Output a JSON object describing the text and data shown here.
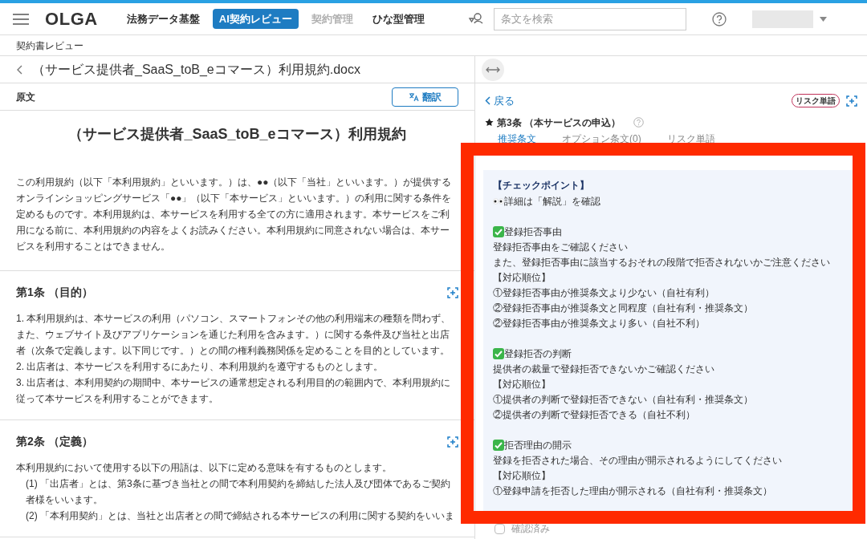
{
  "header": {
    "logo": "OLGA",
    "nav": [
      {
        "label": "法務データ基盤",
        "selected": false,
        "disabled": false
      },
      {
        "label": "AI契約レビュー",
        "selected": true,
        "disabled": false
      },
      {
        "label": "契約管理",
        "selected": false,
        "disabled": true
      },
      {
        "label": "ひな型管理",
        "selected": false,
        "disabled": false
      }
    ],
    "search": {
      "placeholder": "条文を検索"
    }
  },
  "breadcrumb": "契約書レビュー",
  "document": {
    "file_name": "（サービス提供者_SaaS_toB_eコマース）利用規約.docx",
    "original_label": "原文",
    "translate_button": "翻訳",
    "title": "（サービス提供者_SaaS_toB_eコマース）利用規約",
    "intro": "この利用規約（以下「本利用規約」といいます。）は、●●（以下「当社」といいます。）が提供するオンラインショッピングサービス「●●」（以下「本サービス」といいます。）の利用に関する条件を定めるものです。本利用規約は、本サービスを利用する全ての方に適用されます。本サービスをご利用になる前に、本利用規約の内容をよくお読みください。本利用規約に同意されない場合は、本サービスを利用することはできません。",
    "sections": [
      {
        "heading": "第1条 （目的）",
        "paragraphs": [
          {
            "kind": "plain",
            "text": "1. 本利用規約は、本サービスの利用（パソコン、スマートフォンその他の利用端末の種類を問わず、また、ウェブサイト及びアプリケーションを通じた利用を含みます。）に関する条件及び当社と出店者（次条で定義します。以下同じです。）との間の権利義務関係を定めることを目的としています。"
          },
          {
            "kind": "plain",
            "text": "2. 出店者は、本サービスを利用するにあたり、本利用規約を遵守するものとします。"
          },
          {
            "kind": "plain",
            "text": "3. 出店者は、本利用契約の期間中、本サービスの通常想定される利用目的の範囲内で、本利用規約に従って本サービスを利用することができます。"
          }
        ]
      },
      {
        "heading": "第2条 （定義）",
        "paragraphs": [
          {
            "kind": "plain",
            "text": "本利用規約において使用する以下の用語は、以下に定める意味を有するものとします。"
          },
          {
            "kind": "indented",
            "text": "(1) 「出店者」とは、第3条に基づき当社との間で本利用契約を締結した法人及び団体であるご契約者様をいいます。"
          },
          {
            "kind": "indented",
            "text": "(2) 「本利用契約」とは、当社と出店者との間で締結される本サービスの利用に関する契約をいいま"
          }
        ]
      }
    ]
  },
  "review": {
    "back": "戻る",
    "risk_badge": "リスク単語",
    "article": {
      "title": "第3条 （本サービスの申込）",
      "starred": true
    },
    "tabs": [
      {
        "label": "推奨条文",
        "selected": true
      },
      {
        "label": "オプション条文(0)",
        "selected": false
      },
      {
        "label": "リスク単語",
        "selected": false
      }
    ],
    "checkpoint": {
      "heading": "【チェックポイント】",
      "lines": [
        {
          "kind": "eyes",
          "text": "詳細は「解説」を確認"
        },
        {
          "kind": "check",
          "text": "登録拒否事由"
        },
        {
          "kind": "text",
          "text": "登録拒否事由をご確認ください"
        },
        {
          "kind": "text",
          "text": "また、登録拒否事由に該当するおそれの段階で拒否されないかご注意ください"
        },
        {
          "kind": "text",
          "text": "【対応順位】"
        },
        {
          "kind": "text",
          "text": "①登録拒否事由が推奨条文より少ない（自社有利）"
        },
        {
          "kind": "text",
          "text": "②登録拒否事由が推奨条文と同程度（自社有利・推奨条文）"
        },
        {
          "kind": "text",
          "text": "②登録拒否事由が推奨条文より多い（自社不利）"
        },
        {
          "kind": "check",
          "text": "登録拒否の判断"
        },
        {
          "kind": "text",
          "text": "提供者の裁量で登録拒否できないかご確認ください"
        },
        {
          "kind": "text",
          "text": "【対応順位】"
        },
        {
          "kind": "text",
          "text": "①提供者の判断で登録拒否できない（自社有利・推奨条文）"
        },
        {
          "kind": "text",
          "text": "②提供者の判断で登録拒否できる（自社不利）"
        },
        {
          "kind": "check",
          "text": "拒否理由の開示"
        },
        {
          "kind": "text",
          "text": "登録を拒否された場合、その理由が開示されるようにしてください"
        },
        {
          "kind": "text",
          "text": "【対応順位】"
        },
        {
          "kind": "text",
          "text": "①登録申請を拒否した理由が開示される（自社有利・推奨条文）"
        }
      ]
    },
    "confirmed": {
      "label": "確認済み",
      "checked": false
    }
  }
}
